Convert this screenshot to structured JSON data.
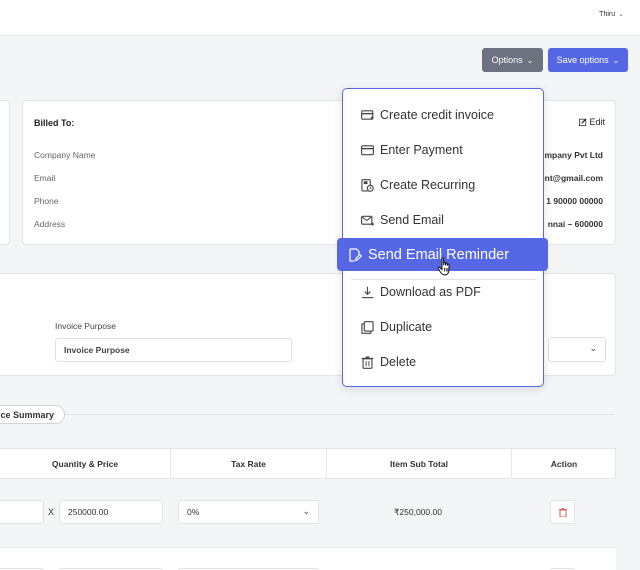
{
  "header": {
    "user_name": "Thiru"
  },
  "toolbar": {
    "options_label": "Options",
    "save_options_label": "Save options"
  },
  "billed_to": {
    "title": "Billed To:",
    "edit_label": "Edit",
    "fields": [
      {
        "label": "Company Name",
        "value": "mpany Pvt Ltd"
      },
      {
        "label": "Email",
        "value": "ent@gmail.com"
      },
      {
        "label": "Phone",
        "value": "1 90000 00000"
      },
      {
        "label": "Address",
        "value": "nnai – 600000"
      }
    ]
  },
  "purpose": {
    "label": "Invoice Purpose",
    "value": "Invoice Purpose"
  },
  "summary": {
    "pill_label": "ce Summary"
  },
  "table": {
    "headers": [
      "Quantity & Price",
      "Tax Rate",
      "Item Sub Total",
      "Action"
    ],
    "rows": [
      {
        "price": "250000.00",
        "tax": "0%",
        "subtotal": "₹250,000.00"
      }
    ],
    "multiply_sign": "X"
  },
  "menu": {
    "items": [
      {
        "label": "Create credit invoice",
        "icon": "credit-card-plus-icon"
      },
      {
        "label": "Enter Payment",
        "icon": "card-icon"
      },
      {
        "label": "Create Recurring",
        "icon": "recurring-icon"
      },
      {
        "label": "Send Email",
        "icon": "mail-icon"
      },
      {
        "label": "Send Email Reminder",
        "icon": "file-edit-icon",
        "active": true
      },
      {
        "label": "Download as PDF",
        "icon": "download-icon"
      },
      {
        "label": "Duplicate",
        "icon": "copy-icon"
      },
      {
        "label": "Delete",
        "icon": "trash-icon"
      }
    ]
  },
  "colors": {
    "accent": "#5567e4",
    "options_button": "#6c7280",
    "delete_icon": "#e05a5a"
  }
}
